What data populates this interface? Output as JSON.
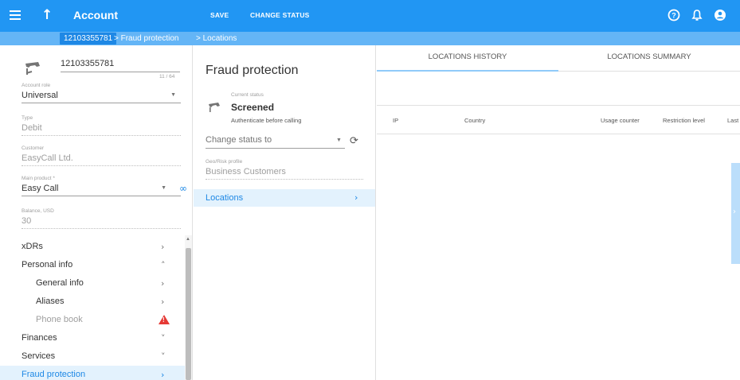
{
  "topbar": {
    "title": "Account",
    "save_label": "SAVE",
    "change_status_label": "CHANGE STATUS"
  },
  "breadcrumb": {
    "account_id": "12103355781",
    "section": "> Fraud protection",
    "current": "> Locations"
  },
  "account": {
    "id": "12103355781",
    "counter": "11 / 64",
    "role_label": "Account role",
    "role_value": "Universal",
    "type_label": "Type",
    "type_value": "Debit",
    "customer_label": "Customer",
    "customer_value": "EasyCall Ltd.",
    "product_label": "Main product *",
    "product_value": "Easy Call",
    "balance_label": "Balance, USD",
    "balance_value": "30"
  },
  "sidebar": {
    "items": [
      {
        "label": "xDRs"
      },
      {
        "label": "Personal info"
      },
      {
        "label": "General info"
      },
      {
        "label": "Aliases"
      },
      {
        "label": "Phone book"
      },
      {
        "label": "Finances"
      },
      {
        "label": "Services"
      },
      {
        "label": "Fraud protection"
      }
    ]
  },
  "fraud": {
    "title": "Fraud protection",
    "status_label": "Current status",
    "status_value": "Screened",
    "status_desc": "Authenticate before calling",
    "change_status_placeholder": "Change status to",
    "geo_label": "Geo/Risk profile",
    "geo_value": "Business Customers",
    "nav_locations": "Locations"
  },
  "tabs": [
    {
      "label": "LOCATIONS HISTORY",
      "active": true
    },
    {
      "label": "LOCATIONS SUMMARY",
      "active": false
    }
  ],
  "table": {
    "columns": [
      "IP",
      "Country",
      "Usage counter",
      "Restriction level",
      "Last"
    ]
  },
  "colors": {
    "topbar": "#2196f3",
    "breadcrumb": "#64b5f6",
    "active_item": "#e3f2fd",
    "accent": "#1e88e5",
    "warning": "#e53935"
  }
}
